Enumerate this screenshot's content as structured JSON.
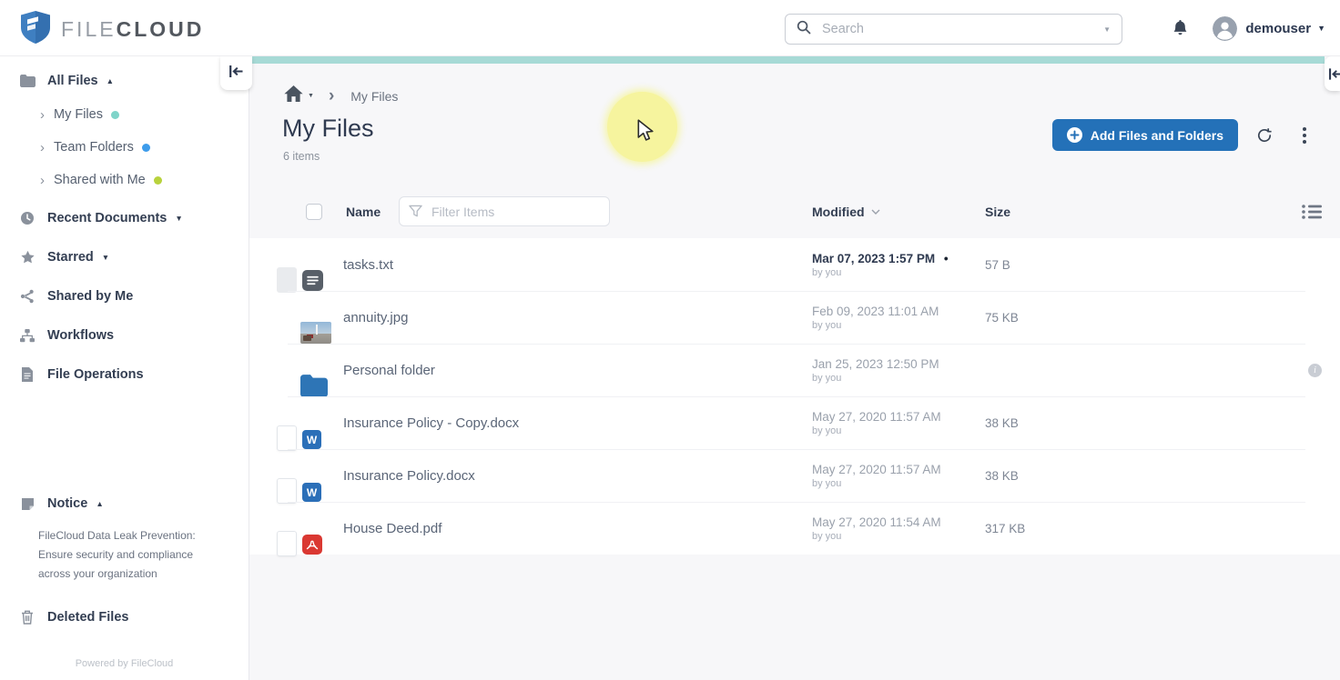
{
  "header": {
    "logo_file": "FILE",
    "logo_cloud": "CLOUD",
    "search_placeholder": "Search",
    "username": "demouser"
  },
  "sidebar": {
    "items": [
      {
        "label": "All Files",
        "icon": "folder-icon",
        "caret": "up",
        "level": 0
      },
      {
        "label": "My Files",
        "icon": "chevron-right-icon",
        "dot_color": "#7fd4c9",
        "level": 1
      },
      {
        "label": "Team Folders",
        "icon": "chevron-right-icon",
        "dot_color": "#3d9ceb",
        "level": 1
      },
      {
        "label": "Shared with Me",
        "icon": "chevron-right-icon",
        "dot_color": "#b8d23c",
        "level": 1
      },
      {
        "label": "Recent Documents",
        "icon": "clock-icon",
        "caret": "down",
        "level": 0,
        "gap": true
      },
      {
        "label": "Starred",
        "icon": "star-icon",
        "caret": "down",
        "level": 0,
        "gap": true
      },
      {
        "label": "Shared by Me",
        "icon": "share-icon",
        "level": 0,
        "gap": true
      },
      {
        "label": "Workflows",
        "icon": "sitemap-icon",
        "level": 0,
        "gap": true
      },
      {
        "label": "File Operations",
        "icon": "file-icon",
        "level": 0,
        "gap": true
      }
    ],
    "notice": {
      "label": "Notice",
      "text": "FileCloud Data Leak Prevention: Ensure security and compliance across your organization"
    },
    "deleted_label": "Deleted Files",
    "footer": "Powered by FileCloud"
  },
  "breadcrumb": {
    "current": "My Files"
  },
  "page": {
    "title": "My Files",
    "item_count": "6 items",
    "add_button_label": "Add Files and Folders"
  },
  "table": {
    "name_header": "Name",
    "filter_placeholder": "Filter Items",
    "modified_header": "Modified",
    "size_header": "Size",
    "rows": [
      {
        "name": "tasks.txt",
        "type": "txt",
        "modified": "Mar 07, 2023 1:57 PM",
        "recent": true,
        "by": "by you",
        "size": "57 B"
      },
      {
        "name": "annuity.jpg",
        "type": "image",
        "modified": "Feb 09, 2023 11:01 AM",
        "recent": false,
        "by": "by you",
        "size": "75 KB"
      },
      {
        "name": "Personal folder",
        "type": "folder",
        "modified": "Jan 25, 2023 12:50 PM",
        "recent": false,
        "by": "by you",
        "size": "",
        "info": true
      },
      {
        "name": "Insurance Policy - Copy.docx",
        "type": "docx",
        "modified": "May 27, 2020 11:57 AM",
        "recent": false,
        "by": "by you",
        "size": "38 KB"
      },
      {
        "name": "Insurance Policy.docx",
        "type": "docx",
        "modified": "May 27, 2020 11:57 AM",
        "recent": false,
        "by": "by you",
        "size": "38 KB"
      },
      {
        "name": "House Deed.pdf",
        "type": "pdf",
        "modified": "May 27, 2020 11:54 AM",
        "recent": false,
        "by": "by you",
        "size": "317 KB"
      }
    ]
  },
  "colors": {
    "accent_blue": "#2471b8",
    "teal_bar": "#a7dad6",
    "highlight_yellow": "#f6f49e"
  }
}
